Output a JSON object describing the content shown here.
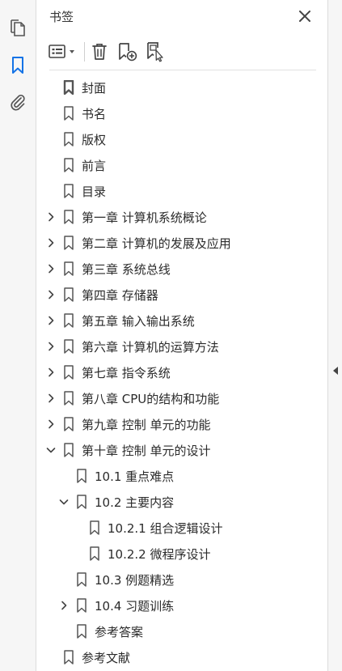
{
  "panel": {
    "title": "书签"
  },
  "rail": {
    "icons": [
      "pages-icon",
      "bookmark-icon",
      "attachment-icon"
    ],
    "active": "bookmark-icon",
    "accent": "#1473e6"
  },
  "toolbar": {
    "icons": [
      "options-menu-icon",
      "delete-icon",
      "new-bookmark-icon",
      "bookmark-from-structure-icon"
    ]
  },
  "bookmarks": [
    {
      "label": "封面",
      "level": 0,
      "expand": "none",
      "selected": true
    },
    {
      "label": "书名",
      "level": 0,
      "expand": "none"
    },
    {
      "label": "版权",
      "level": 0,
      "expand": "none"
    },
    {
      "label": "前言",
      "level": 0,
      "expand": "none"
    },
    {
      "label": "目录",
      "level": 0,
      "expand": "none"
    },
    {
      "label": "第一章 计算机系统概论",
      "level": 0,
      "expand": "collapsed"
    },
    {
      "label": "第二章 计算机的发展及应用",
      "level": 0,
      "expand": "collapsed"
    },
    {
      "label": "第三章 系统总线",
      "level": 0,
      "expand": "collapsed"
    },
    {
      "label": "第四章 存储器",
      "level": 0,
      "expand": "collapsed"
    },
    {
      "label": "第五章 输入输出系统",
      "level": 0,
      "expand": "collapsed"
    },
    {
      "label": "第六章 计算机的运算方法",
      "level": 0,
      "expand": "collapsed"
    },
    {
      "label": "第七章 指令系统",
      "level": 0,
      "expand": "collapsed"
    },
    {
      "label": "第八章 CPU的结构和功能",
      "level": 0,
      "expand": "collapsed"
    },
    {
      "label": "第九章 控制 单元的功能",
      "level": 0,
      "expand": "collapsed"
    },
    {
      "label": "第十章 控制 单元的设计",
      "level": 0,
      "expand": "expanded"
    },
    {
      "label": "10.1 重点难点",
      "level": 1,
      "expand": "none"
    },
    {
      "label": "10.2 主要内容",
      "level": 1,
      "expand": "expanded"
    },
    {
      "label": "10.2.1 组合逻辑设计",
      "level": 2,
      "expand": "none"
    },
    {
      "label": "10.2.2 微程序设计",
      "level": 2,
      "expand": "none"
    },
    {
      "label": "10.3 例题精选",
      "level": 1,
      "expand": "none"
    },
    {
      "label": "10.4 习题训练",
      "level": 1,
      "expand": "collapsed"
    },
    {
      "label": "参考答案",
      "level": 1,
      "expand": "none"
    },
    {
      "label": "参考文献",
      "level": 0,
      "expand": "none"
    }
  ]
}
